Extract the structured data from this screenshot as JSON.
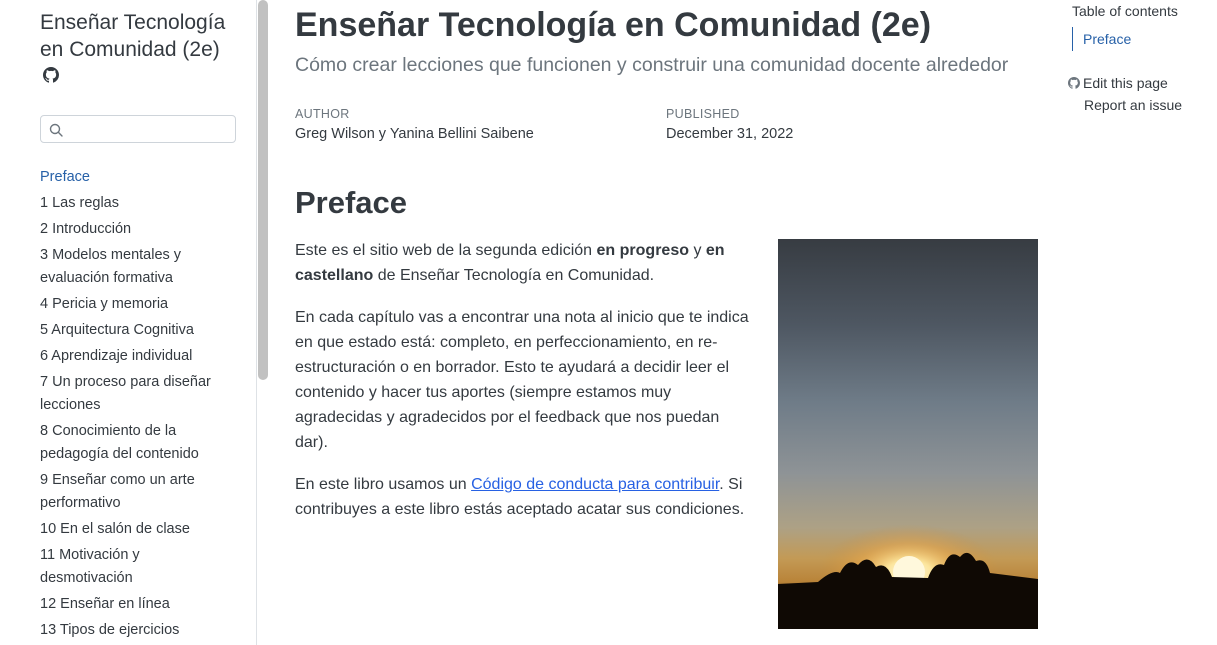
{
  "sidebar": {
    "title": "Enseñar Tecnología en Comunidad (2e)",
    "search_placeholder": "",
    "items": [
      {
        "label": "Preface",
        "active": true
      },
      {
        "label": "1  Las reglas"
      },
      {
        "label": "2  Introducción"
      },
      {
        "label": "3  Modelos mentales y evaluación formativa"
      },
      {
        "label": "4  Pericia y memoria"
      },
      {
        "label": "5  Arquitectura Cognitiva"
      },
      {
        "label": "6  Aprendizaje individual"
      },
      {
        "label": "7  Un proceso para diseñar lecciones"
      },
      {
        "label": "8  Conocimiento de la pedagogía del contenido"
      },
      {
        "label": "9  Enseñar como un arte performativo"
      },
      {
        "label": "10  En el salón de clase"
      },
      {
        "label": "11  Motivación y desmotivación"
      },
      {
        "label": "12  Enseñar en línea"
      },
      {
        "label": "13  Tipos de ejercicios"
      }
    ]
  },
  "header": {
    "title": "Enseñar Tecnología en Comunidad (2e)",
    "subtitle": "Cómo crear lecciones que funcionen y construir una comunidad docente alrededor",
    "author_label": "AUTHOR",
    "author": "Greg Wilson y Yanina Bellini Saibene",
    "published_label": "PUBLISHED",
    "published": "December 31, 2022"
  },
  "content": {
    "section_title": "Preface",
    "p1_a": "Este es el sitio web de la segunda edición ",
    "p1_b": "en progreso",
    "p1_c": " y ",
    "p1_d": "en castellano",
    "p1_e": " de Enseñar Tecnología en Comunidad.",
    "p2": "En cada capítulo vas a encontrar una nota al inicio que te indica en que estado está: completo, en perfeccionamiento, en re-estructuración o en borrador. Esto te ayudará a decidir leer el contenido y hacer tus aportes (siempre estamos muy agradecidas y agradecidos por el feedback que nos puedan dar).",
    "p3_a": "En este libro usamos un ",
    "p3_link": "Código de conducta para contribuir",
    "p3_b": ". Si contribuyes a este libro estás aceptado acatar sus condiciones."
  },
  "toc": {
    "title": "Table of contents",
    "items": [
      "Preface"
    ],
    "edit_label": "Edit this page",
    "issue_label": "Report an issue"
  },
  "colors": {
    "accent": "#2761a8",
    "link": "#2761e3",
    "text": "#343a40",
    "muted": "#6c757d"
  }
}
